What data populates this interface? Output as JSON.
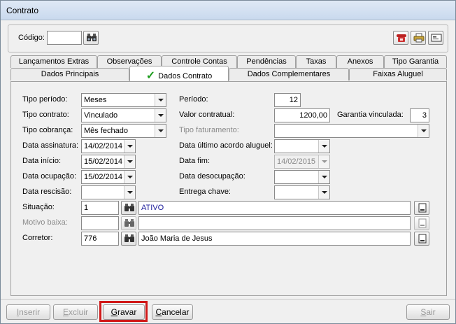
{
  "window": {
    "title": "Contrato"
  },
  "header": {
    "code_label": "Código:",
    "code_value": ""
  },
  "tabs_row1": [
    "Lançamentos Extras",
    "Observações",
    "Controle Contas",
    "Pendências",
    "Taxas",
    "Anexos",
    "Tipo Garantia"
  ],
  "tabs_row2": [
    "Dados Principais",
    "Dados Contrato",
    "Dados Complementares",
    "Faixas Aluguel"
  ],
  "active_tab": "Dados Contrato",
  "form": {
    "tipo_periodo": {
      "label": "Tipo período:",
      "value": "Meses"
    },
    "periodo": {
      "label": "Período:",
      "value": "12"
    },
    "tipo_contrato": {
      "label": "Tipo contrato:",
      "value": "Vinculado"
    },
    "valor_contratual": {
      "label": "Valor contratual:",
      "value": "1200,00"
    },
    "garantia_vinculada": {
      "label": "Garantia vinculada:",
      "value": "3"
    },
    "tipo_cobranca": {
      "label": "Tipo cobrança:",
      "value": "Mês fechado"
    },
    "tipo_faturamento": {
      "label": "Tipo faturamento:",
      "value": ""
    },
    "data_assinatura": {
      "label": "Data assinatura:",
      "value": "14/02/2014"
    },
    "data_ultimo_acordo": {
      "label": "Data último acordo aluguel:",
      "value": ""
    },
    "data_inicio": {
      "label": "Data início:",
      "value": "15/02/2014"
    },
    "data_fim": {
      "label": "Data fim:",
      "value": "14/02/2015"
    },
    "data_ocupacao": {
      "label": "Data ocupação:",
      "value": "15/02/2014"
    },
    "data_desocupacao": {
      "label": "Data desocupação:",
      "value": ""
    },
    "data_rescisao": {
      "label": "Data rescisão:",
      "value": ""
    },
    "entrega_chave": {
      "label": "Entrega chave:",
      "value": ""
    },
    "situacao": {
      "label": "Situação:",
      "code": "1",
      "desc": "ATIVO"
    },
    "motivo_baixa": {
      "label": "Motivo baixa:",
      "code": "",
      "desc": ""
    },
    "corretor": {
      "label": "Corretor:",
      "code": "776",
      "desc": "João Maria de Jesus"
    }
  },
  "footer": {
    "inserir_first": "I",
    "inserir_rest": "nserir",
    "excluir_first": "E",
    "excluir_rest": "xcluir",
    "gravar_first": "G",
    "gravar_rest": "ravar",
    "cancelar_first": "C",
    "cancelar_rest": "ancelar",
    "sair_first": "S",
    "sair_rest": "air"
  },
  "colors": {
    "highlight": "#d01818",
    "check": "#1f9d1f",
    "value_blue": "#1a1a9a"
  },
  "icons": [
    "binoculars-icon",
    "phone-icon",
    "printer-icon",
    "card-icon",
    "document-icon",
    "check-icon",
    "dropdown-arrow-icon"
  ]
}
